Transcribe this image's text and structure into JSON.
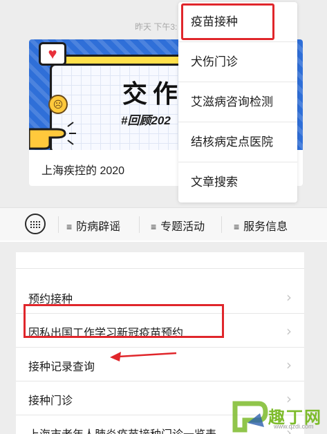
{
  "article": {
    "timestamp": "昨天 下午3:",
    "cover_title": "交作",
    "cover_tag": "#回顾202",
    "title": "上海疾控的 2020"
  },
  "dropdown_menu": {
    "items": [
      {
        "label": "疫苗接种",
        "highlighted": true
      },
      {
        "label": "犬伤门诊"
      },
      {
        "label": "艾滋病咨询检测"
      },
      {
        "label": "结核病定点医院"
      },
      {
        "label": "文章搜索"
      }
    ]
  },
  "tab_bar": {
    "menu_glyph": "≡",
    "tabs": [
      {
        "label": "防病辟谣"
      },
      {
        "label": "专题活动"
      },
      {
        "label": "服务信息"
      }
    ]
  },
  "list": {
    "rows": [
      {
        "label": "预约接种"
      },
      {
        "label": "因私出国工作学习新冠疫苗预约",
        "highlighted": true
      },
      {
        "label": "接种记录查询",
        "arrow_pointer": true
      },
      {
        "label": "接种门诊"
      },
      {
        "label": "上海市老年人肺炎疫苗接种门诊一览表"
      }
    ]
  },
  "watermark": {
    "text": "趣丁网",
    "url": "www.qzdi.com"
  },
  "colors": {
    "highlight_red": "#e0262b",
    "page_gray": "#ededed",
    "watermark_green": "#7dbb2b"
  }
}
